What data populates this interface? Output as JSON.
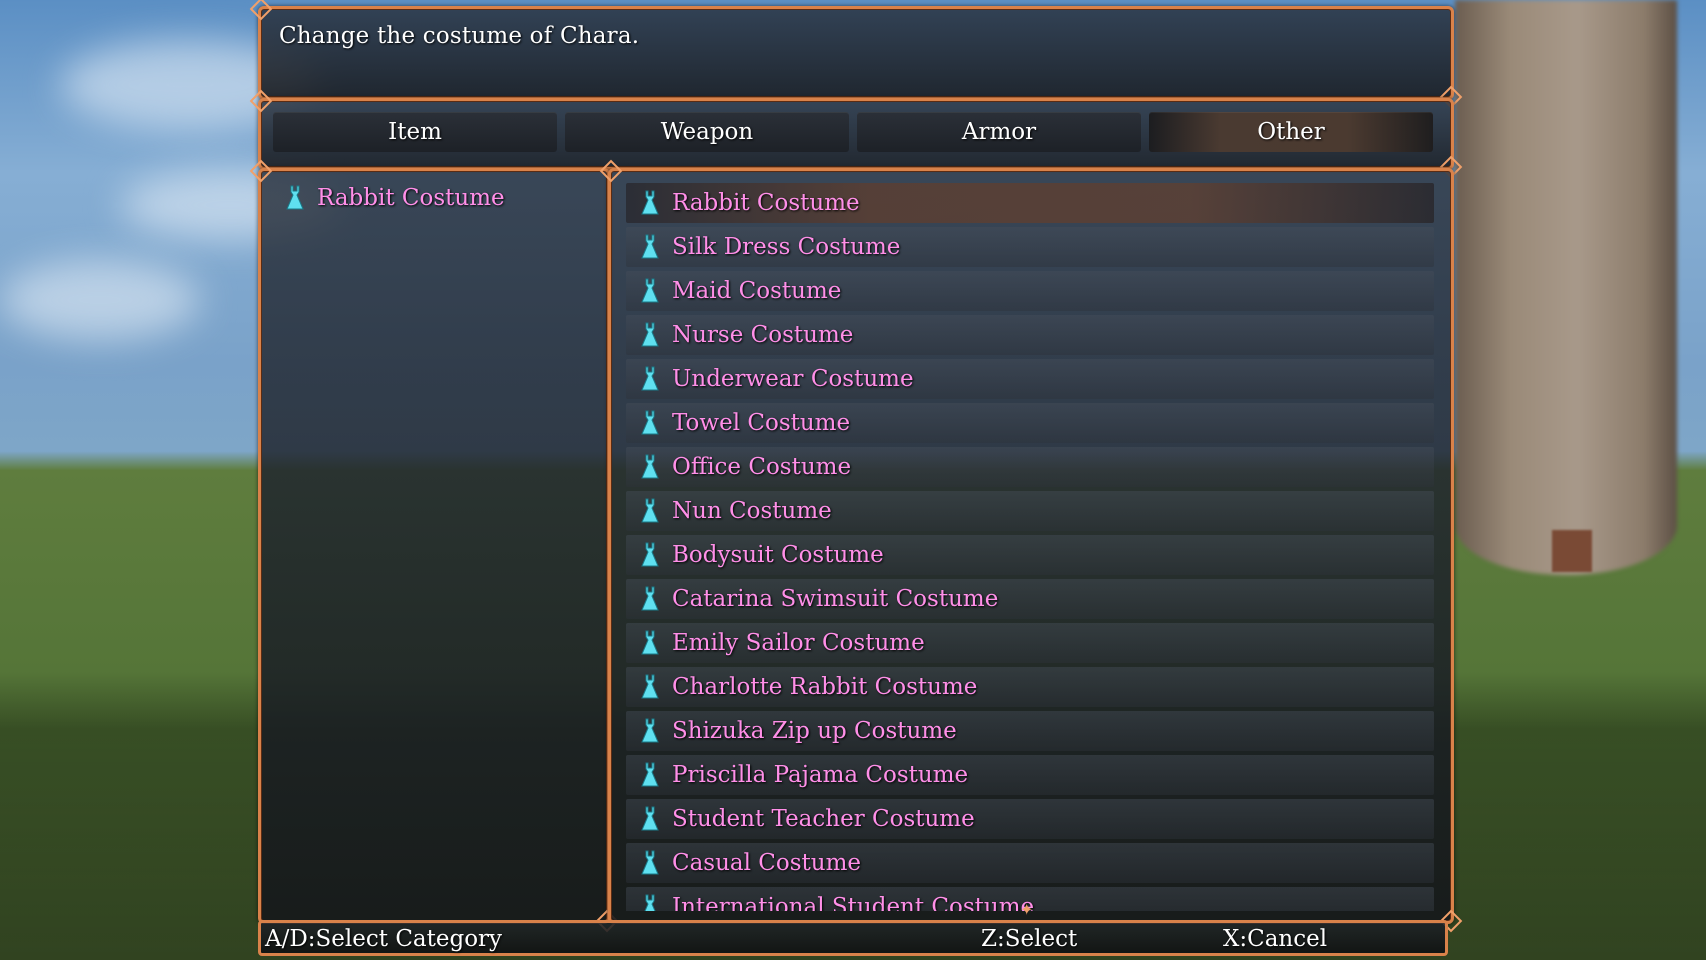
{
  "help": {
    "text": "Change the costume of Chara."
  },
  "tabs": [
    {
      "label": "Item",
      "active": false
    },
    {
      "label": "Weapon",
      "active": false
    },
    {
      "label": "Armor",
      "active": false
    },
    {
      "label": "Other",
      "active": true
    }
  ],
  "equipped": {
    "label": "Rabbit Costume",
    "icon": "dress-icon"
  },
  "costumes": [
    "Rabbit Costume",
    "Silk Dress Costume",
    "Maid Costume",
    "Nurse Costume",
    "Underwear Costume",
    "Towel Costume",
    "Office Costume",
    "Nun Costume",
    "Bodysuit Costume",
    "Catarina Swimsuit Costume",
    "Emily Sailor Costume",
    "Charlotte Rabbit Costume",
    "Shizuka Zip up Costume",
    "Priscilla Pajama Costume",
    "Student Teacher Costume",
    "Casual Costume",
    "International Student Costume"
  ],
  "selected_index": 0,
  "footer": {
    "category": "A/D:Select Category",
    "select": "Z:Select",
    "cancel": "X:Cancel"
  },
  "colors": {
    "accent": "#d9824a",
    "item_text": "#ff8fe8",
    "icon": "#5fe0f0"
  }
}
